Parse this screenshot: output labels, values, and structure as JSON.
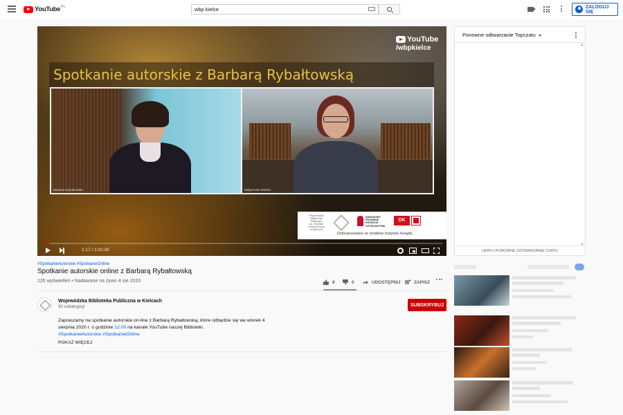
{
  "header": {
    "logo_text": "YouTube",
    "logo_region": "PL",
    "search_value": "wbp kielce",
    "signin_label": "ZALOGUJ SIĘ"
  },
  "player": {
    "watermark_brand": "YouTube",
    "watermark_handle": "/wbpkielce",
    "video_overlay_title": "Spotkanie autorskie z Barbarą Rybałtowską",
    "left_name_tag": "Barbara Rybałtowska",
    "right_name_tag": "Małgorzata Winkler",
    "sponsor": {
      "library_lines": [
        "Wojewódzka",
        "Biblioteka",
        "Publiczna",
        "im. Witolda",
        "Gombrowicza",
        "w Kielcach"
      ],
      "npr_lines": [
        "NARODOWY",
        "PROGRAM",
        "ROZWOJU",
        "CZYTELNICTWA"
      ],
      "dk_label": "DK",
      "funding_text": "Dofinansowano ze środków Instytutu Książki."
    },
    "time_display": "1:17 / 1:01:30",
    "progress_fraction": 0.021
  },
  "video": {
    "hashtags": [
      "#SpotkanieAutorskie",
      "#SpotkanieOnline"
    ],
    "title": "Spotkanie autorskie online z Barbarą Rybałtowską",
    "meta": "126 wyświetleń • Nadawane na żywo 4 sie 2020",
    "likes": "8",
    "dislikes": "0",
    "share_label": "UDOSTĘPNIJ",
    "save_label": "ZAPISZ"
  },
  "channel": {
    "name": "Wojewódzka Biblioteka Publiczna w Kielcach",
    "subscribers": "30 subskrypcji",
    "subscribe_label": "SUBSKRYBUJ",
    "description_line1": "Zapraszamy na spotkanie autorskie on-line z Barbarą Rybałtowską, które odbędzie się we wtorek 4 sierpnia 2020 r. o godzinie",
    "description_time": "12:00",
    "description_line2": "na kanale YouTube naszej Biblioteki.",
    "description_tags": "#SpotkanieAutorskie #SpotkanieOnline",
    "show_more_label": "POKAŻ WIĘCEJ"
  },
  "chat": {
    "mode_label": "Ponowne odtwarzanie Topczatu",
    "hide_label": "UKRYJ PONOWNE ODTWARZANIE CZATU"
  },
  "colors": {
    "accent_blue": "#065fd4",
    "brand_red": "#ff0000",
    "subscribe_red": "#cc0000",
    "overlay_title_gold": "#e8c14a"
  }
}
